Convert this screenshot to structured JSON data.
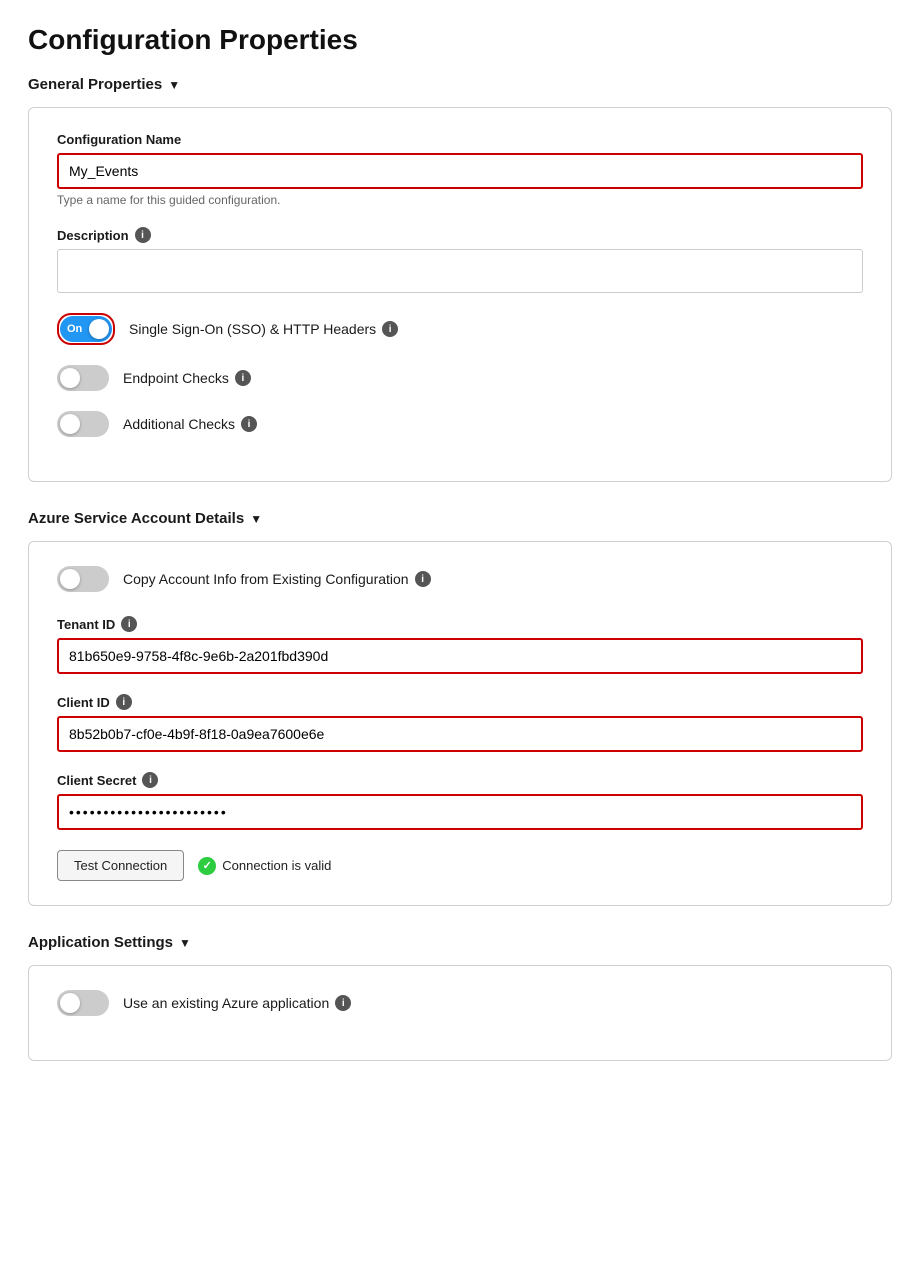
{
  "page": {
    "title": "Configuration Properties"
  },
  "general_properties": {
    "section_label": "General Properties",
    "chevron": "▼",
    "config_name_label": "Configuration Name",
    "config_name_value": "My_Events",
    "config_name_hint": "Type a name for this guided configuration.",
    "description_label": "Description",
    "description_value": "",
    "description_placeholder": "",
    "sso_label": "Single Sign-On (SSO) & HTTP Headers",
    "sso_toggle": "on",
    "sso_toggle_text": "On",
    "endpoint_checks_label": "Endpoint Checks",
    "endpoint_toggle": "off",
    "additional_checks_label": "Additional Checks",
    "additional_toggle": "off"
  },
  "azure_section": {
    "section_label": "Azure Service Account Details",
    "chevron": "▼",
    "copy_account_label": "Copy Account Info from Existing Configuration",
    "copy_toggle": "off",
    "tenant_id_label": "Tenant ID",
    "tenant_id_value": "81b650e9-9758-4f8c-9e6b-2a201fbd390d",
    "client_id_label": "Client ID",
    "client_id_value": "8b52b0b7-cf0e-4b9f-8f18-0a9ea7600e6e",
    "client_secret_label": "Client Secret",
    "client_secret_value": "••••••••••••••••••••••••••••",
    "test_button_label": "Test Connection",
    "connection_valid_text": "Connection is valid"
  },
  "app_settings": {
    "section_label": "Application Settings",
    "chevron": "▼",
    "use_existing_azure_label": "Use an existing Azure application",
    "use_existing_toggle": "off"
  },
  "icons": {
    "info": "i",
    "check": "✓",
    "chevron_down": "▼"
  }
}
